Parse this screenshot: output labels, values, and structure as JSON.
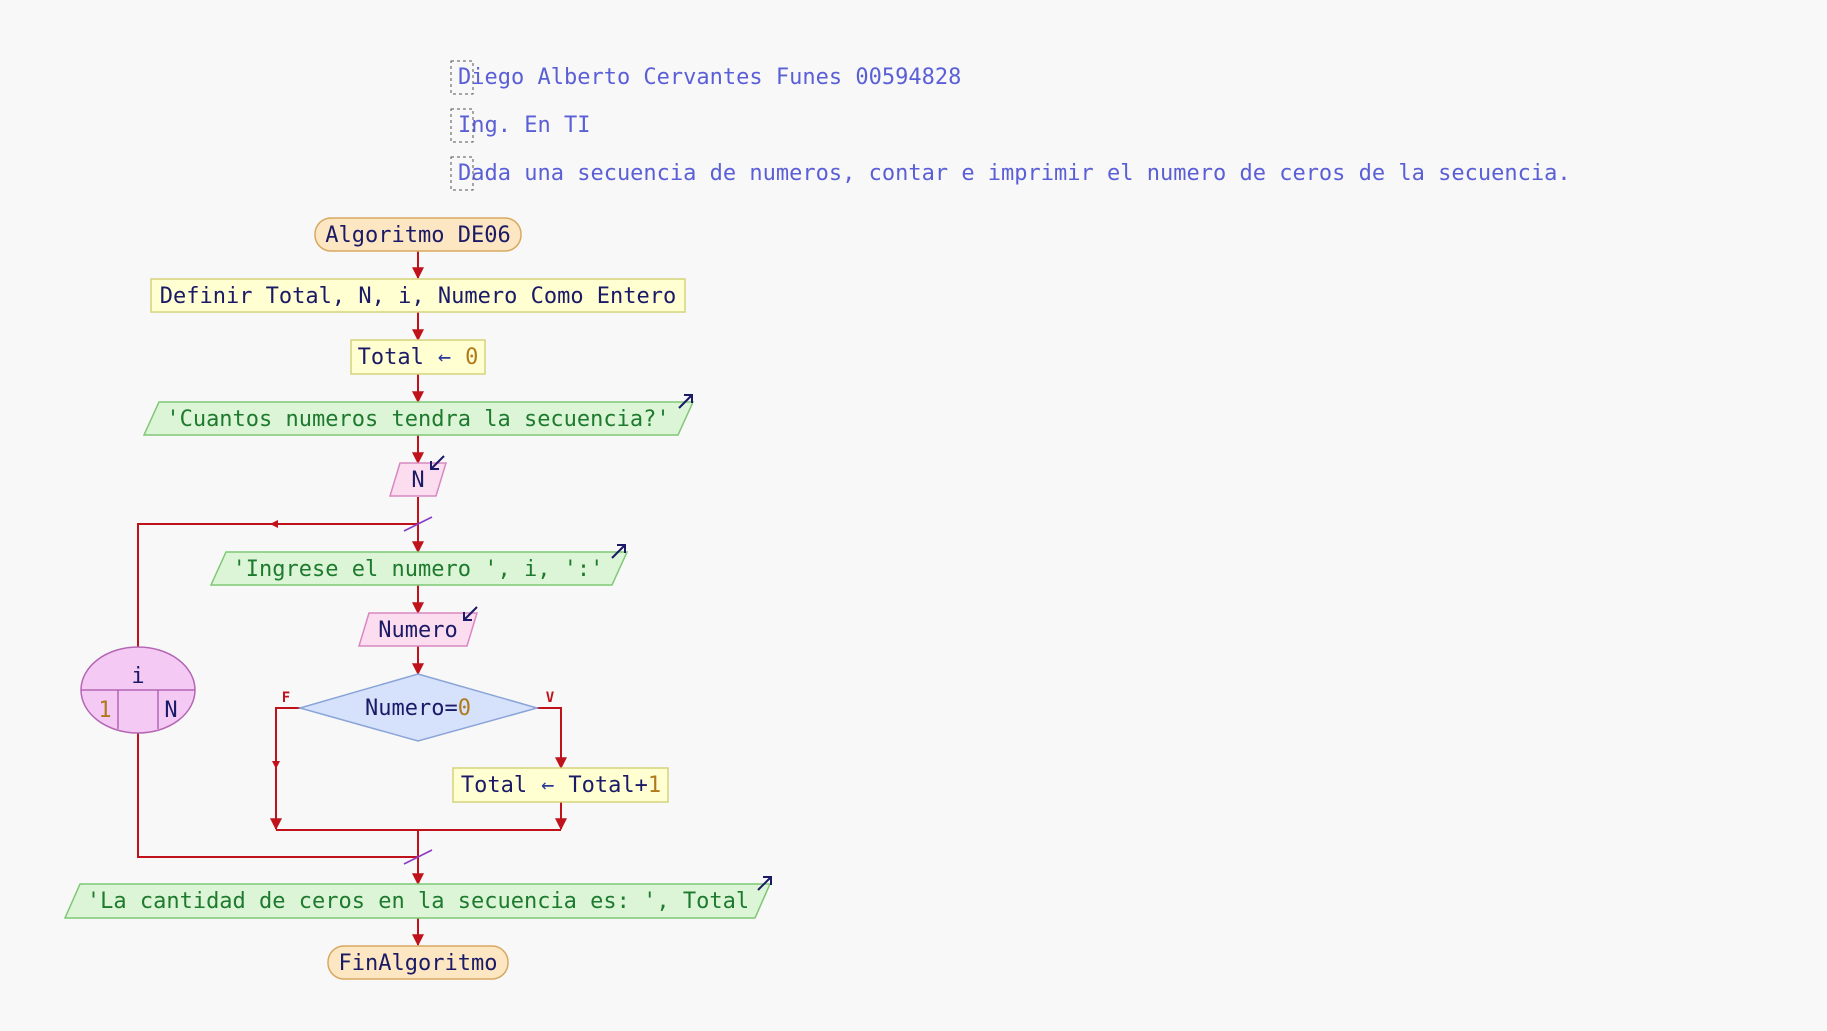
{
  "comments": [
    "Diego Alberto Cervantes Funes 00594828",
    "Ing. En TI",
    "Dada una secuencia de numeros, contar e imprimir el numero de ceros de la secuencia."
  ],
  "start_label": "Algoritmo DE06",
  "define": "Definir Total, N, i, Numero Como Entero",
  "assign_total": {
    "var": "Total",
    "arrow": "←",
    "value": "0"
  },
  "prompt_count": "'Cuantos numeros tendra la secuencia?'",
  "read_n": "N",
  "prompt_number": "'Ingrese el numero ', i, ':'",
  "read_number": "Numero",
  "condition": {
    "left": "Numero=",
    "right": "0"
  },
  "branch_false": "F",
  "branch_true": "V",
  "increment": {
    "var": "Total",
    "arrow": "←",
    "expr": "Total+",
    "value": "1"
  },
  "loop": {
    "var": "i",
    "from": "1",
    "to": "N"
  },
  "output_result": "'La cantidad de ceros en la secuencia es: ', Total",
  "end_label": "FinAlgoritmo",
  "colors": {
    "background": "#f8f8f8",
    "flow_line": "#c0121b",
    "terminal_fill": "#fde6c2",
    "terminal_stroke": "#d9a860",
    "process_fill": "#ffffd2",
    "process_stroke": "#d6d27a",
    "output_fill": "#dcf5d6",
    "output_stroke": "#7ec874",
    "input_fill": "#fcdcef",
    "input_stroke": "#d888c0",
    "decision_fill": "#d6e2fb",
    "decision_stroke": "#8aa4d8",
    "loop_fill": "#f4caf4",
    "loop_stroke": "#b466b4",
    "comment_text": "#5b5fd6",
    "string_text": "#1e7a2e",
    "number_text": "#b07a1a",
    "code_text": "#1a1a66"
  }
}
